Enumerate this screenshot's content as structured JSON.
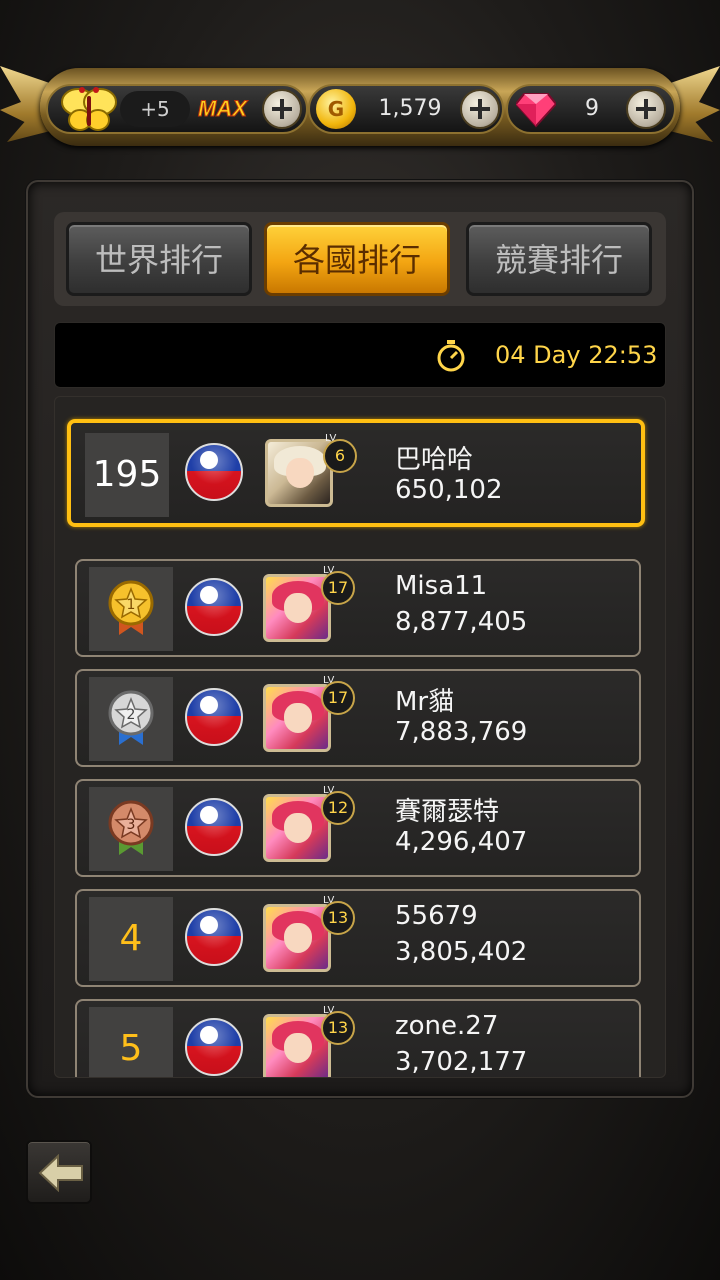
{
  "resources": {
    "energy_bonus": "+5",
    "energy_status": "MAX",
    "gold": "1,579",
    "gems": "9"
  },
  "tabs": [
    {
      "label": "世界排行",
      "active": false
    },
    {
      "label": "各國排行",
      "active": true
    },
    {
      "label": "競賽排行",
      "active": false
    }
  ],
  "timer": "04 Day 22:53",
  "lv_label": "LV",
  "my_entry": {
    "rank": "195",
    "level": "6",
    "name": "巴哈哈",
    "score": "650,102"
  },
  "rankings": [
    {
      "rank": "1",
      "level": "17",
      "name": "Misa11",
      "score": "8,877,405",
      "medal": "gold"
    },
    {
      "rank": "2",
      "level": "17",
      "name": "Mr貓",
      "score": "7,883,769",
      "medal": "silver"
    },
    {
      "rank": "3",
      "level": "12",
      "name": "賽爾瑟特",
      "score": "4,296,407",
      "medal": "bronze"
    },
    {
      "rank": "4",
      "level": "13",
      "name": "55679",
      "score": "3,805,402"
    },
    {
      "rank": "5",
      "level": "13",
      "name": "zone.27",
      "score": "3,702,177"
    }
  ],
  "colors": {
    "accent": "#ffbf12",
    "active_tab": "#f3a512",
    "timer_text": "#ffd54a"
  }
}
